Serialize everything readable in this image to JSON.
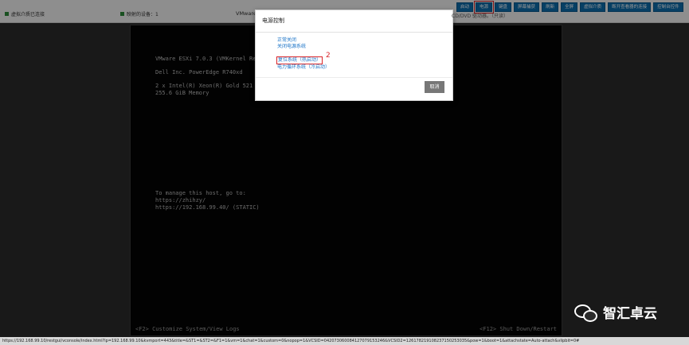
{
  "status": {
    "virtual_media": "虚拟介质已连接",
    "mapped_devices": "映射的设备：1",
    "vmware_prefix": "VMware",
    "cd_status": "CD/DVD 驱动器。（只读）"
  },
  "toolbar": {
    "buttons": [
      "启动",
      "电源",
      "键盘",
      "屏幕捕获",
      "刷新",
      "全屏",
      "虚拟介质",
      "断开查看器的连接",
      "控制台控件"
    ]
  },
  "console": {
    "lines": [
      "VMware ESXi 7.0.3 (VMKernel Re",
      "",
      "Dell Inc. PowerEdge R740xd",
      "",
      "2 x Intel(R) Xeon(R) Gold 521",
      "255.6 GiB Memory"
    ],
    "manage_lines": [
      "To manage this host, go to:",
      "https://zhihzy/",
      "https://192.168.99.40/ (STATIC)"
    ],
    "footer_left": "<F2> Customize System/View Logs",
    "footer_right": "<F12> Shut Down/Restart"
  },
  "url": "https://192.168.99.10/restgui/vconsole/index.html?ip=192.168.99.10&kvmport=443&title=&ST1=&ST2=&F1=1&vm=1&chat=1&custom=0&nopop=1&VCSID=042073060084127079153246&VCSID2=126178219108237150253035&pow=1&boot=1&attachstate=Auto-attach&vlipbit=0#",
  "modal": {
    "title": "电源控制",
    "options": [
      "正常关闭",
      "关闭电源系统",
      "复位系统（热启动）",
      "电力循环系统（冷启动）"
    ],
    "annotation": "2",
    "cancel": "取消"
  },
  "watermark": "智汇卓云"
}
